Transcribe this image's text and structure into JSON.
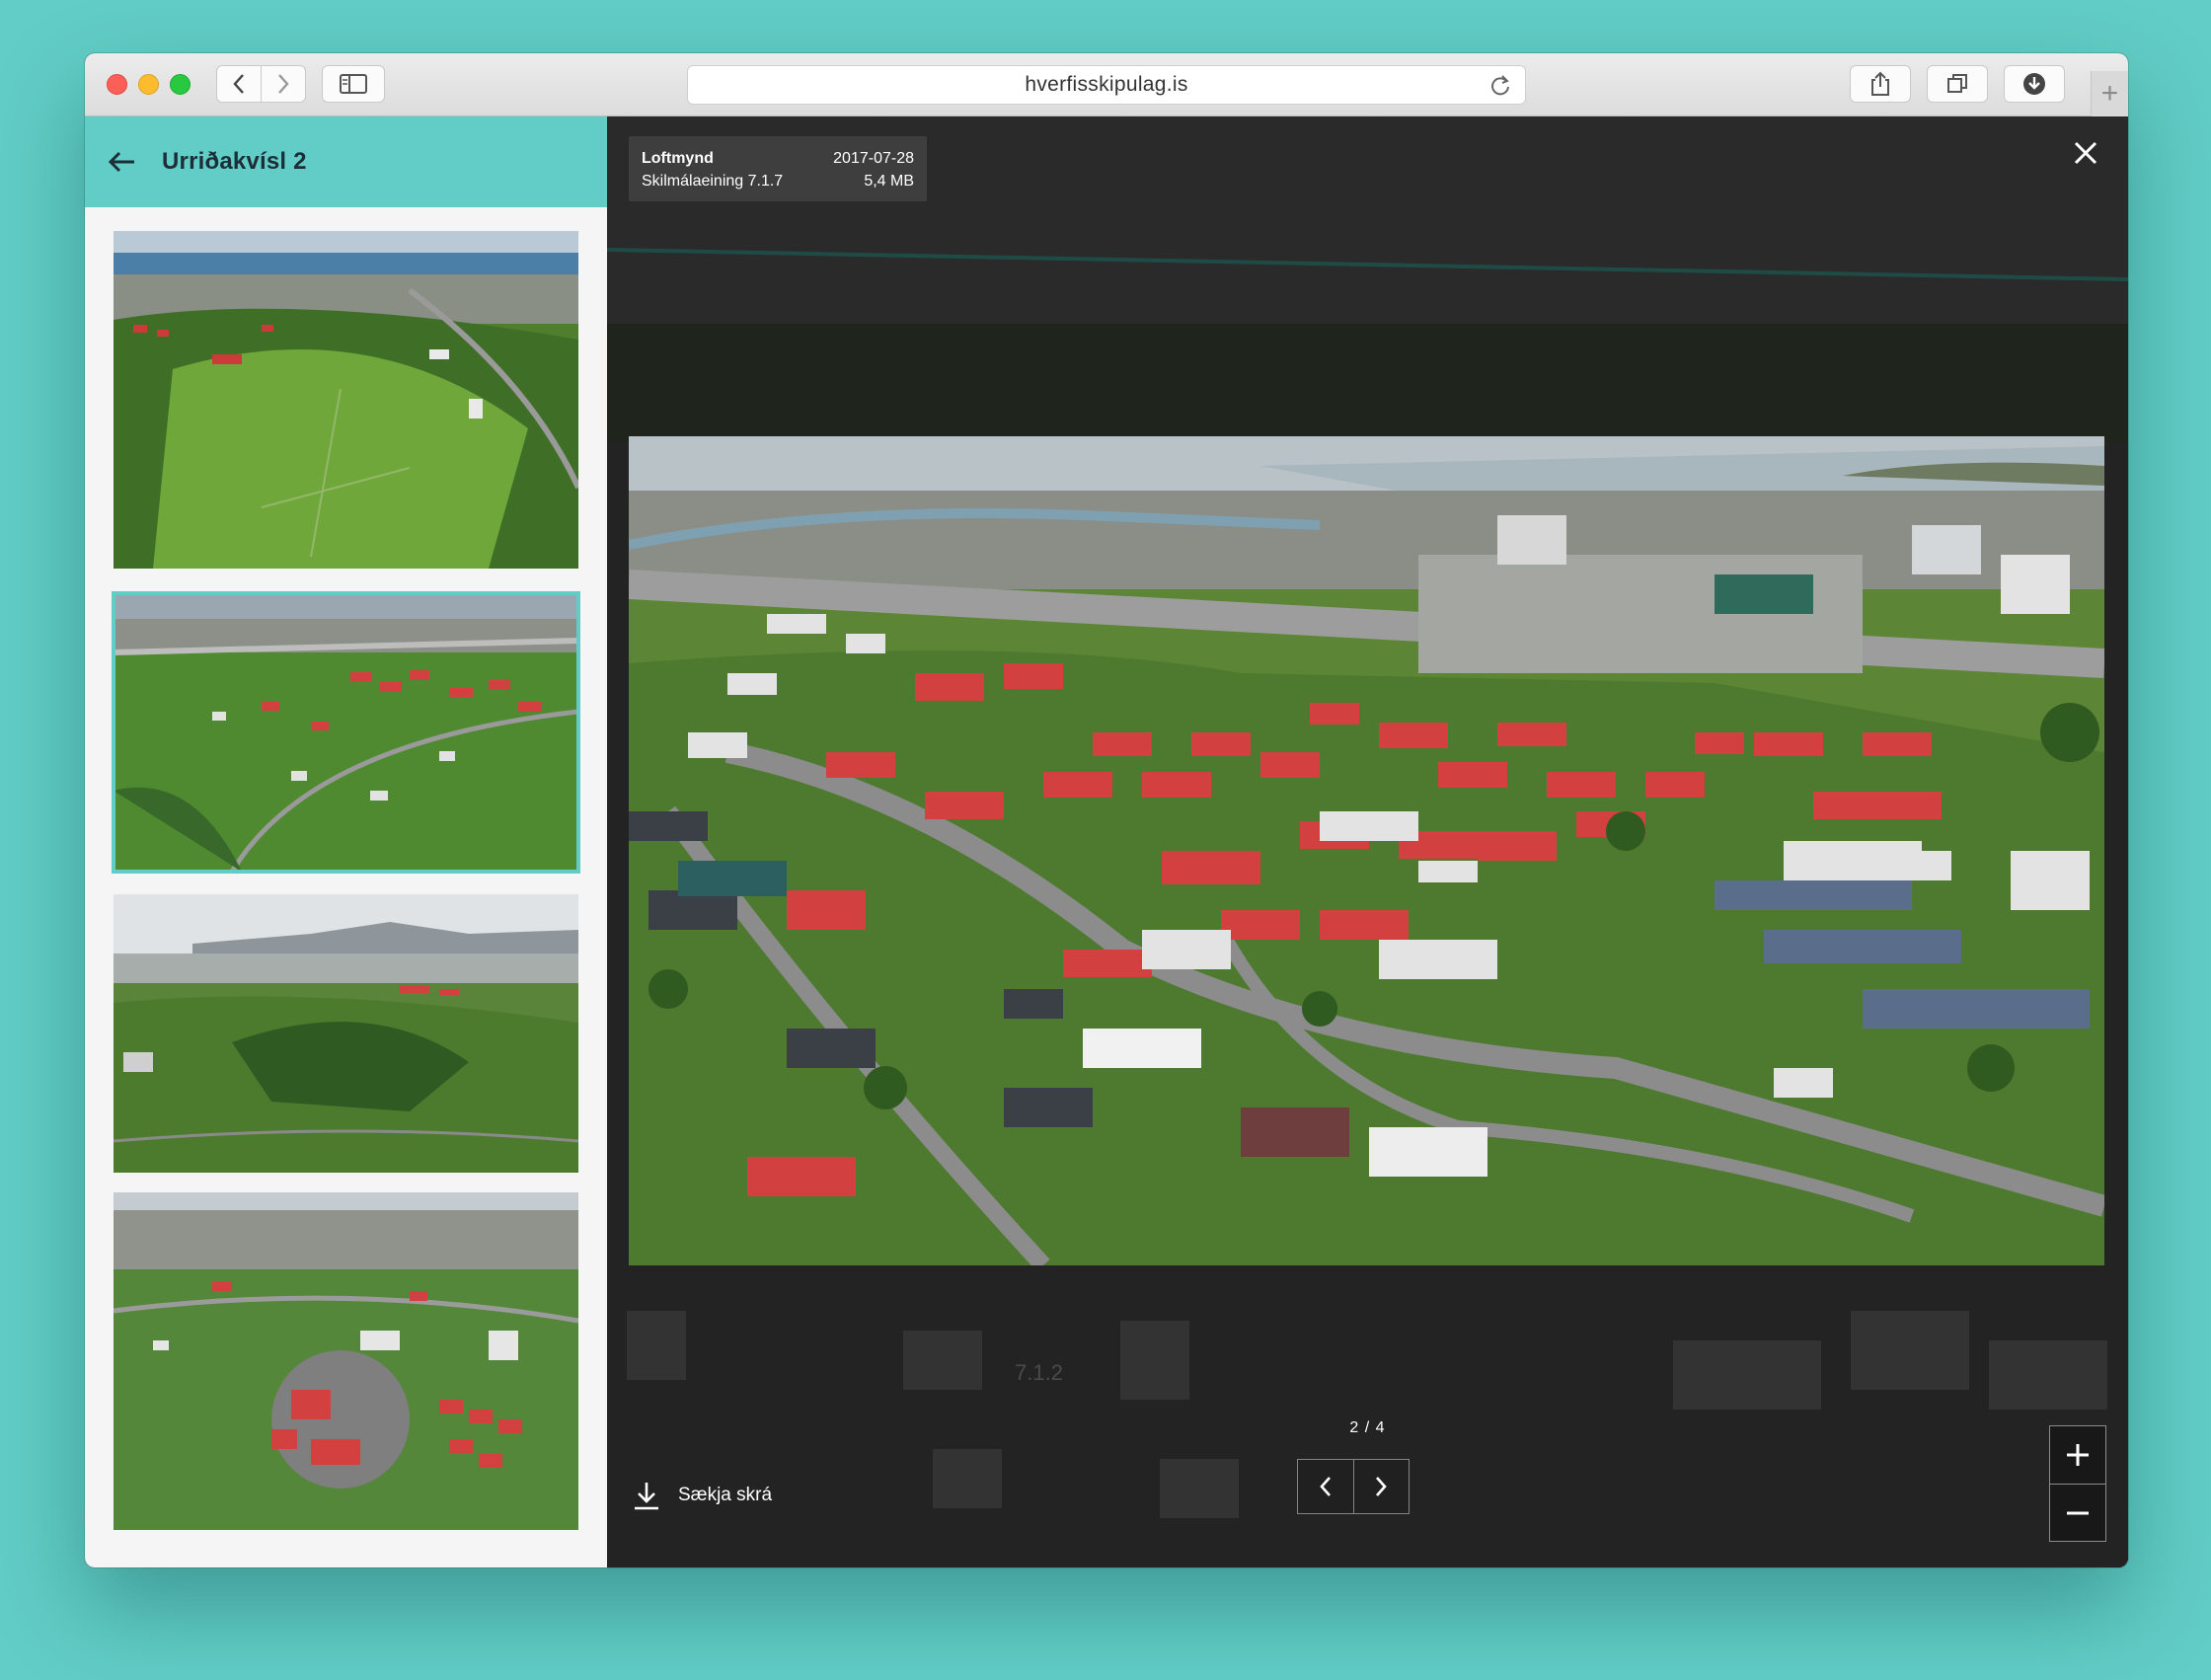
{
  "browser": {
    "url": "hverfisskipulag.is"
  },
  "sidebar": {
    "title": "Urriðakvísl 2",
    "thumbnails": [
      {
        "selected": false
      },
      {
        "selected": true
      },
      {
        "selected": false
      },
      {
        "selected": false
      }
    ]
  },
  "viewer": {
    "meta": {
      "type": "Loftmynd",
      "date": "2017-07-28",
      "unit": "Skilmálaeining 7.1.7",
      "size": "5,4 MB"
    },
    "map_label": "7.1.2",
    "counter": "2 / 4",
    "download_label": "Sækja skrá"
  },
  "colors": {
    "accent": "#61cdc6",
    "roof_red": "#d2413f",
    "grass": "#5b8a2e"
  }
}
